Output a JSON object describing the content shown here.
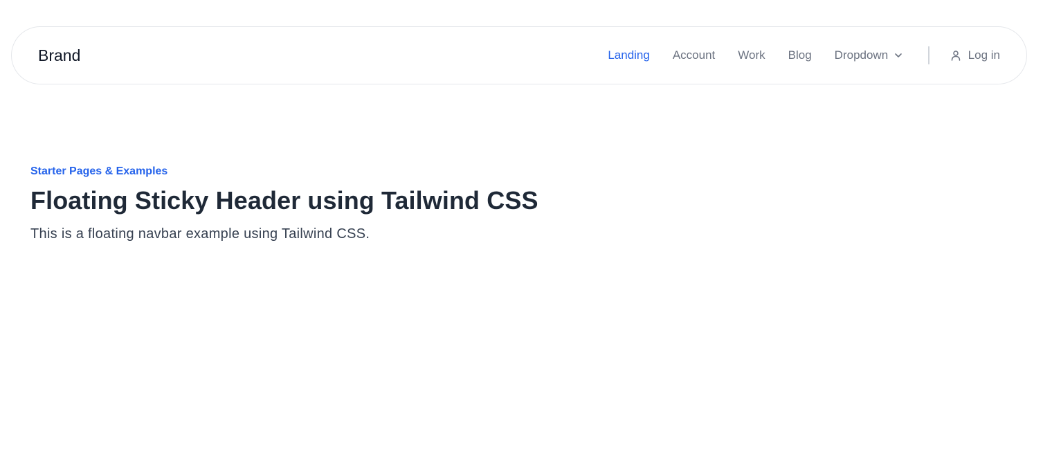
{
  "navbar": {
    "brand": "Brand",
    "links": [
      {
        "label": "Landing"
      },
      {
        "label": "Account"
      },
      {
        "label": "Work"
      },
      {
        "label": "Blog"
      },
      {
        "label": "Dropdown"
      }
    ],
    "active_link": "Landing",
    "dropdown_icon": "chevron-down-icon",
    "login": {
      "label": "Log in",
      "icon": "user-icon"
    }
  },
  "hero": {
    "eyebrow": "Starter Pages & Examples",
    "title": "Floating Sticky Header using Tailwind CSS",
    "subtitle": "This is a floating navbar example using Tailwind CSS."
  },
  "colors": {
    "accent": "#2563eb",
    "text_primary": "#1f2937",
    "text_muted": "#6b7280",
    "border": "#e5e7eb"
  }
}
